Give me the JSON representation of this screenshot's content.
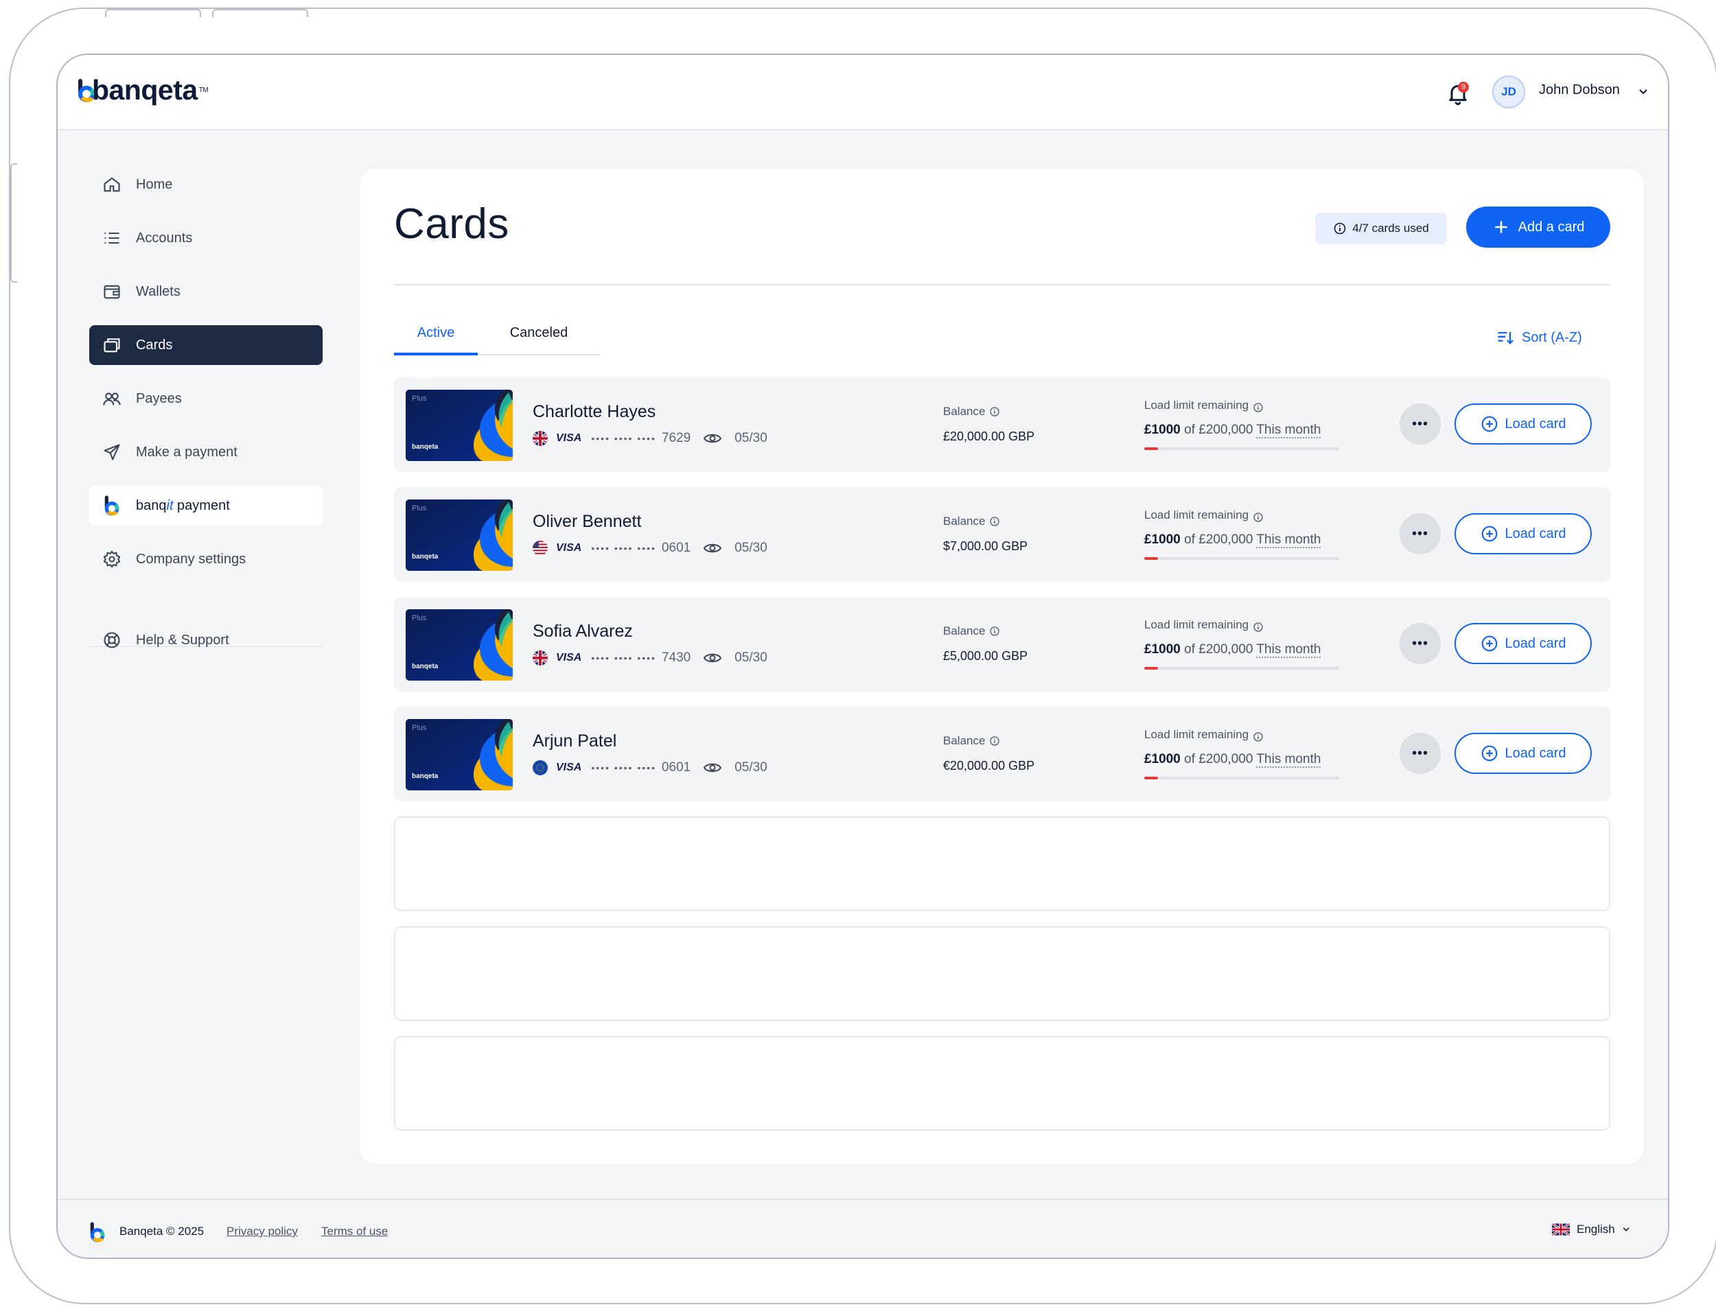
{
  "app": {
    "name": "banqeta"
  },
  "header": {
    "notifications_count": "9",
    "user_initials": "JD",
    "user_name": "John Dobson"
  },
  "sidebar": {
    "items": [
      {
        "label": "Home"
      },
      {
        "label": "Accounts"
      },
      {
        "label": "Wallets"
      },
      {
        "label": "Cards"
      },
      {
        "label": "Payees"
      },
      {
        "label": "Make a payment"
      },
      {
        "label_prefix": "banq",
        "label_italic": "it",
        "label_suffix": " payment"
      },
      {
        "label": "Company settings"
      },
      {
        "label": "Help & Support"
      }
    ]
  },
  "page": {
    "title": "Cards",
    "cards_used": "4/7 cards used",
    "add_card_label": "Add a card",
    "tabs": [
      {
        "label": "Active"
      },
      {
        "label": "Canceled"
      }
    ],
    "sort_label": "Sort (A-Z)"
  },
  "cards": [
    {
      "name": "Charlotte Hayes",
      "flag": "uk",
      "brand": "VISA",
      "masked": "•••• •••• ••••",
      "last4": "7629",
      "expiry": "05/30",
      "balance_label": "Balance",
      "balance": "£20,000.00 GBP",
      "limit_label": "Load limit remaining",
      "limit_amount": "£1000",
      "limit_of": " of £200,000 ",
      "limit_period": "This month",
      "limit_used_fraction": 0.07,
      "load_label": "Load card",
      "card_tier": "Plus",
      "card_brand": "banqeta"
    },
    {
      "name": "Oliver Bennett",
      "flag": "us",
      "brand": "VISA",
      "masked": "•••• •••• ••••",
      "last4": "0601",
      "expiry": "05/30",
      "balance_label": "Balance",
      "balance": "$7,000.00 GBP",
      "limit_label": "Load limit remaining",
      "limit_amount": "£1000",
      "limit_of": " of £200,000 ",
      "limit_period": "This month",
      "limit_used_fraction": 0.07,
      "load_label": "Load card",
      "card_tier": "Plus",
      "card_brand": "banqeta"
    },
    {
      "name": "Sofia Alvarez",
      "flag": "uk",
      "brand": "VISA",
      "masked": "•••• •••• ••••",
      "last4": "7430",
      "expiry": "05/30",
      "balance_label": "Balance",
      "balance": "£5,000.00 GBP",
      "limit_label": "Load limit remaining",
      "limit_amount": "£1000",
      "limit_of": " of £200,000 ",
      "limit_period": "This month",
      "limit_used_fraction": 0.07,
      "load_label": "Load card",
      "card_tier": "Plus",
      "card_brand": "banqeta"
    },
    {
      "name": "Arjun Patel",
      "flag": "eu",
      "brand": "VISA",
      "masked": "•••• •••• ••••",
      "last4": "0601",
      "expiry": "05/30",
      "balance_label": "Balance",
      "balance": "€20,000.00 GBP",
      "limit_label": "Load limit remaining",
      "limit_amount": "£1000",
      "limit_of": " of £200,000 ",
      "limit_period": "This month",
      "limit_used_fraction": 0.07,
      "load_label": "Load card",
      "card_tier": "Plus",
      "card_brand": "banqeta"
    }
  ],
  "footer": {
    "copyright": "Banqeta © 2025",
    "privacy": "Privacy policy",
    "terms": "Terms of use",
    "language": "English"
  },
  "colors": {
    "primary": "#1064f3",
    "nav_active": "#1d2b45",
    "danger": "#e53935",
    "surface": "#f4f5f7"
  }
}
